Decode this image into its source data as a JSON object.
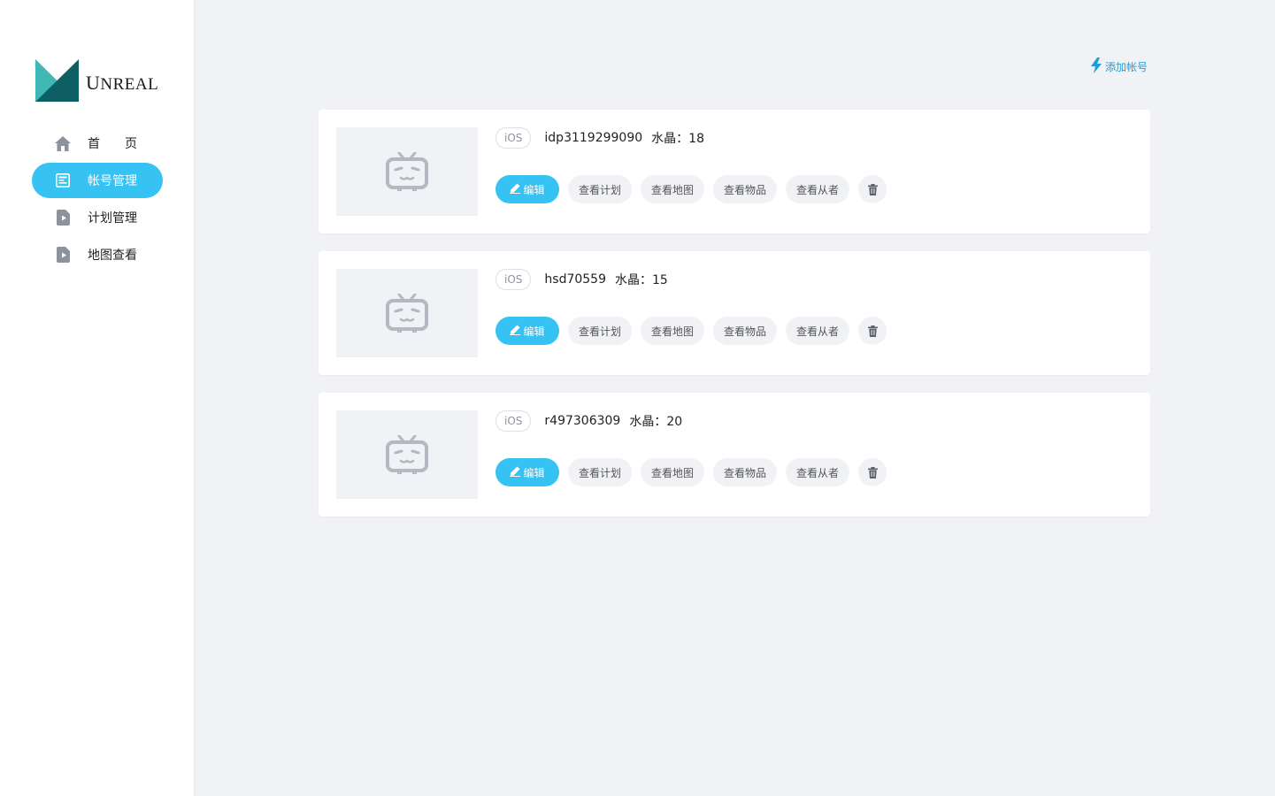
{
  "brand": {
    "name": "Unreal",
    "colors": {
      "light": "#5ccbc9",
      "dark": "#0e5f63"
    }
  },
  "sidebar": {
    "items": [
      {
        "label": "首页",
        "icon": "home-icon",
        "active": false
      },
      {
        "label": "帐号管理",
        "icon": "account-card-icon",
        "active": true
      },
      {
        "label": "计划管理",
        "icon": "doc-play-icon",
        "active": false
      },
      {
        "label": "地图查看",
        "icon": "doc-play-icon",
        "active": false
      }
    ]
  },
  "header": {
    "add_account_label": "添加帐号",
    "add_icon": "bolt-icon"
  },
  "colors": {
    "accent": "#36c2f2",
    "link": "#1aa0d8",
    "bg": "#f1f2f6"
  },
  "accounts": [
    {
      "platform": "iOS",
      "name": "idp3119299090",
      "crystal": "水晶：18"
    },
    {
      "platform": "iOS",
      "name": "hsd70559",
      "crystal": "水晶：15"
    },
    {
      "platform": "iOS",
      "name": "r497306309",
      "crystal": "水晶：20"
    }
  ],
  "actions": {
    "edit": "编辑",
    "view_plan": "查看计划",
    "view_map": "查看地图",
    "view_items": "查看物品",
    "view_followers": "查看从者",
    "delete_icon": "trash-icon",
    "placeholder_icon": "tv-placeholder-icon"
  }
}
